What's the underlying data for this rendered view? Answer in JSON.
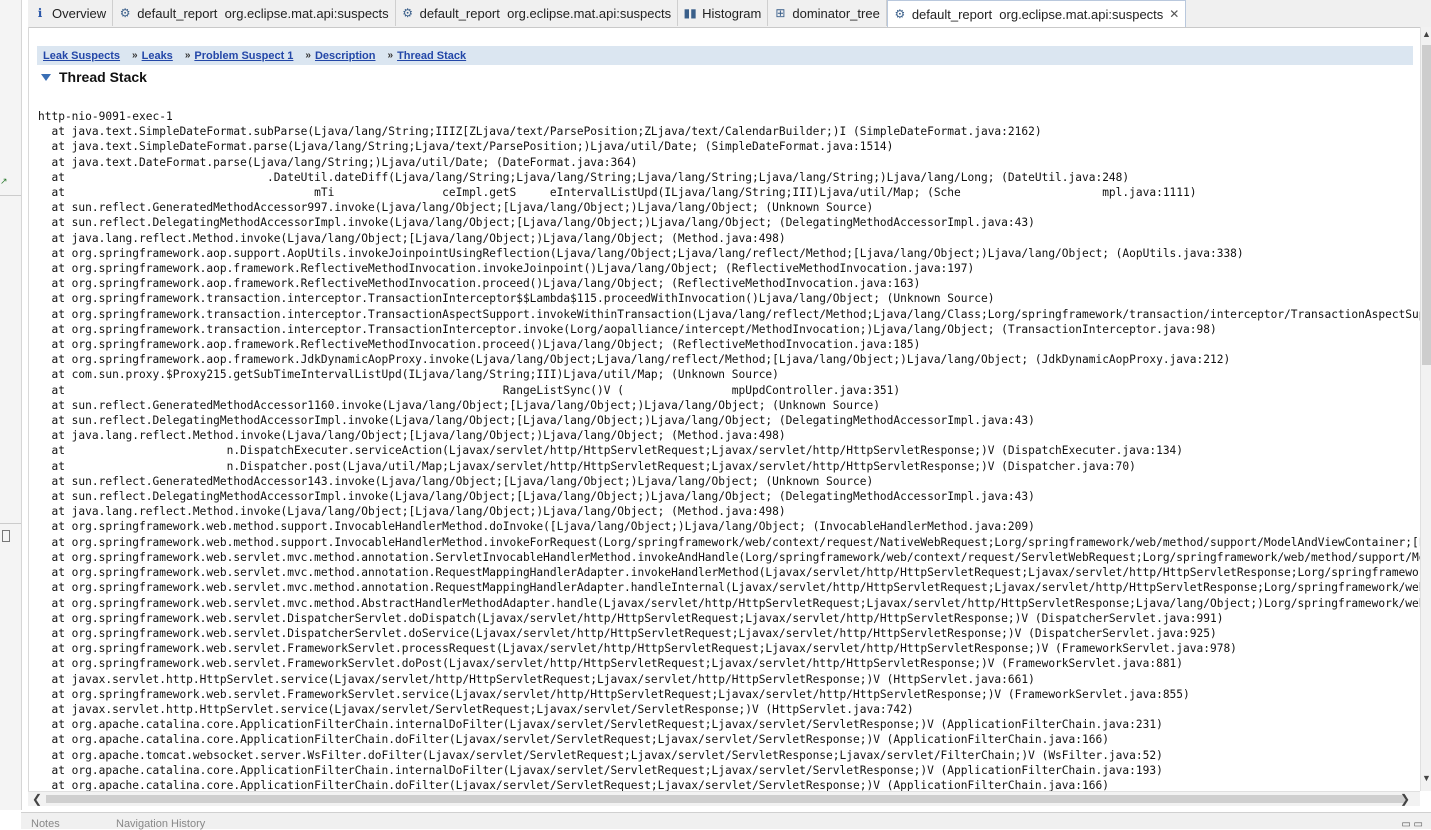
{
  "tabs": [
    {
      "label": "Overview",
      "icon": "info-icon"
    },
    {
      "label": "default_report  org.eclipse.mat.api:suspects",
      "icon": "report-icon"
    },
    {
      "label": "default_report  org.eclipse.mat.api:suspects",
      "icon": "report-icon"
    },
    {
      "label": "Histogram",
      "icon": "histogram-icon"
    },
    {
      "label": "dominator_tree",
      "icon": "tree-icon"
    },
    {
      "label": "default_report  org.eclipse.mat.api:suspects",
      "icon": "report-icon",
      "active": true
    }
  ],
  "breadcrumb": {
    "items": [
      "Leak Suspects",
      "Leaks",
      "Problem Suspect 1",
      "Description",
      "Thread Stack"
    ],
    "separator": "»"
  },
  "section": {
    "title": "Thread Stack"
  },
  "stack": {
    "thread_name": "http-nio-9091-exec-1",
    "frames": [
      "  at java.text.SimpleDateFormat.subParse(Ljava/lang/String;IIIZ[ZLjava/text/ParsePosition;ZLjava/text/CalendarBuilder;)I (SimpleDateFormat.java:2162)",
      "  at java.text.SimpleDateFormat.parse(Ljava/lang/String;Ljava/text/ParsePosition;)Ljava/util/Date; (SimpleDateFormat.java:1514)",
      "  at java.text.DateFormat.parse(Ljava/lang/String;)Ljava/util/Date; (DateFormat.java:364)",
      "  at                              .DateUtil.dateDiff(Ljava/lang/String;Ljava/lang/String;Ljava/lang/String;Ljava/lang/String;)Ljava/lang/Long; (DateUtil.java:248)",
      "  at                                     mTi                ceImpl.getS     eIntervalListUpd(ILjava/lang/String;III)Ljava/util/Map; (Sche                     mpl.java:1111)",
      "  at sun.reflect.GeneratedMethodAccessor997.invoke(Ljava/lang/Object;[Ljava/lang/Object;)Ljava/lang/Object; (Unknown Source)",
      "  at sun.reflect.DelegatingMethodAccessorImpl.invoke(Ljava/lang/Object;[Ljava/lang/Object;)Ljava/lang/Object; (DelegatingMethodAccessorImpl.java:43)",
      "  at java.lang.reflect.Method.invoke(Ljava/lang/Object;[Ljava/lang/Object;)Ljava/lang/Object; (Method.java:498)",
      "  at org.springframework.aop.support.AopUtils.invokeJoinpointUsingReflection(Ljava/lang/Object;Ljava/lang/reflect/Method;[Ljava/lang/Object;)Ljava/lang/Object; (AopUtils.java:338)",
      "  at org.springframework.aop.framework.ReflectiveMethodInvocation.invokeJoinpoint()Ljava/lang/Object; (ReflectiveMethodInvocation.java:197)",
      "  at org.springframework.aop.framework.ReflectiveMethodInvocation.proceed()Ljava/lang/Object; (ReflectiveMethodInvocation.java:163)",
      "  at org.springframework.transaction.interceptor.TransactionInterceptor$$Lambda$115.proceedWithInvocation()Ljava/lang/Object; (Unknown Source)",
      "  at org.springframework.transaction.interceptor.TransactionAspectSupport.invokeWithinTransaction(Ljava/lang/reflect/Method;Ljava/lang/Class;Lorg/springframework/transaction/interceptor/TransactionAspectSuppo",
      "  at org.springframework.transaction.interceptor.TransactionInterceptor.invoke(Lorg/aopalliance/intercept/MethodInvocation;)Ljava/lang/Object; (TransactionInterceptor.java:98)",
      "  at org.springframework.aop.framework.ReflectiveMethodInvocation.proceed()Ljava/lang/Object; (ReflectiveMethodInvocation.java:185)",
      "  at org.springframework.aop.framework.JdkDynamicAopProxy.invoke(Ljava/lang/Object;Ljava/lang/reflect/Method;[Ljava/lang/Object;)Ljava/lang/Object; (JdkDynamicAopProxy.java:212)",
      "  at com.sun.proxy.$Proxy215.getSubTimeIntervalListUpd(ILjava/lang/String;III)Ljava/util/Map; (Unknown Source)",
      "  at                                                                 RangeListSync()V (                mpUpdController.java:351)",
      "  at sun.reflect.GeneratedMethodAccessor1160.invoke(Ljava/lang/Object;[Ljava/lang/Object;)Ljava/lang/Object; (Unknown Source)",
      "  at sun.reflect.DelegatingMethodAccessorImpl.invoke(Ljava/lang/Object;[Ljava/lang/Object;)Ljava/lang/Object; (DelegatingMethodAccessorImpl.java:43)",
      "  at java.lang.reflect.Method.invoke(Ljava/lang/Object;[Ljava/lang/Object;)Ljava/lang/Object; (Method.java:498)",
      "  at                        n.DispatchExecuter.serviceAction(Ljavax/servlet/http/HttpServletRequest;Ljavax/servlet/http/HttpServletResponse;)V (DispatchExecuter.java:134)",
      "  at                        n.Dispatcher.post(Ljava/util/Map;Ljavax/servlet/http/HttpServletRequest;Ljavax/servlet/http/HttpServletResponse;)V (Dispatcher.java:70)",
      "  at sun.reflect.GeneratedMethodAccessor143.invoke(Ljava/lang/Object;[Ljava/lang/Object;)Ljava/lang/Object; (Unknown Source)",
      "  at sun.reflect.DelegatingMethodAccessorImpl.invoke(Ljava/lang/Object;[Ljava/lang/Object;)Ljava/lang/Object; (DelegatingMethodAccessorImpl.java:43)",
      "  at java.lang.reflect.Method.invoke(Ljava/lang/Object;[Ljava/lang/Object;)Ljava/lang/Object; (Method.java:498)",
      "  at org.springframework.web.method.support.InvocableHandlerMethod.doInvoke([Ljava/lang/Object;)Ljava/lang/Object; (InvocableHandlerMethod.java:209)",
      "  at org.springframework.web.method.support.InvocableHandlerMethod.invokeForRequest(Lorg/springframework/web/context/request/NativeWebRequest;Lorg/springframework/web/method/support/ModelAndViewContainer;[Lja",
      "  at org.springframework.web.servlet.mvc.method.annotation.ServletInvocableHandlerMethod.invokeAndHandle(Lorg/springframework/web/context/request/ServletWebRequest;Lorg/springframework/web/method/support/Mode",
      "  at org.springframework.web.servlet.mvc.method.annotation.RequestMappingHandlerAdapter.invokeHandlerMethod(Ljavax/servlet/http/HttpServletRequest;Ljavax/servlet/http/HttpServletResponse;Lorg/springframework.",
      "  at org.springframework.web.servlet.mvc.method.annotation.RequestMappingHandlerAdapter.handleInternal(Ljavax/servlet/http/HttpServletRequest;Ljavax/servlet/http/HttpServletResponse;Lorg/springframework/web/m",
      "  at org.springframework.web.servlet.mvc.method.AbstractHandlerMethodAdapter.handle(Ljavax/servlet/http/HttpServletRequest;Ljavax/servlet/http/HttpServletResponse;Ljava/lang/Object;)Lorg/springframework/web/s",
      "  at org.springframework.web.servlet.DispatcherServlet.doDispatch(Ljavax/servlet/http/HttpServletRequest;Ljavax/servlet/http/HttpServletResponse;)V (DispatcherServlet.java:991)",
      "  at org.springframework.web.servlet.DispatcherServlet.doService(Ljavax/servlet/http/HttpServletRequest;Ljavax/servlet/http/HttpServletResponse;)V (DispatcherServlet.java:925)",
      "  at org.springframework.web.servlet.FrameworkServlet.processRequest(Ljavax/servlet/http/HttpServletRequest;Ljavax/servlet/http/HttpServletResponse;)V (FrameworkServlet.java:978)",
      "  at org.springframework.web.servlet.FrameworkServlet.doPost(Ljavax/servlet/http/HttpServletRequest;Ljavax/servlet/http/HttpServletResponse;)V (FrameworkServlet.java:881)",
      "  at javax.servlet.http.HttpServlet.service(Ljavax/servlet/http/HttpServletRequest;Ljavax/servlet/http/HttpServletResponse;)V (HttpServlet.java:661)",
      "  at org.springframework.web.servlet.FrameworkServlet.service(Ljavax/servlet/http/HttpServletRequest;Ljavax/servlet/http/HttpServletResponse;)V (FrameworkServlet.java:855)",
      "  at javax.servlet.http.HttpServlet.service(Ljavax/servlet/ServletRequest;Ljavax/servlet/ServletResponse;)V (HttpServlet.java:742)",
      "  at org.apache.catalina.core.ApplicationFilterChain.internalDoFilter(Ljavax/servlet/ServletRequest;Ljavax/servlet/ServletResponse;)V (ApplicationFilterChain.java:231)",
      "  at org.apache.catalina.core.ApplicationFilterChain.doFilter(Ljavax/servlet/ServletRequest;Ljavax/servlet/ServletResponse;)V (ApplicationFilterChain.java:166)",
      "  at org.apache.tomcat.websocket.server.WsFilter.doFilter(Ljavax/servlet/ServletRequest;Ljavax/servlet/ServletResponse;Ljavax/servlet/FilterChain;)V (WsFilter.java:52)",
      "  at org.apache.catalina.core.ApplicationFilterChain.internalDoFilter(Ljavax/servlet/ServletRequest;Ljavax/servlet/ServletResponse;)V (ApplicationFilterChain.java:193)",
      "  at org.apache.catalina.core.ApplicationFilterChain.doFilter(Ljavax/servlet/ServletRequest;Ljavax/servlet/ServletResponse;)V (ApplicationFilterChain.java:166)"
    ]
  },
  "bottom_tabs": [
    "Notes",
    "Navigation History"
  ],
  "colors": {
    "accent": "#2347a8",
    "breadcrumb_bg": "#dbe6f1",
    "tab_active_border": "#b9c8dd"
  }
}
